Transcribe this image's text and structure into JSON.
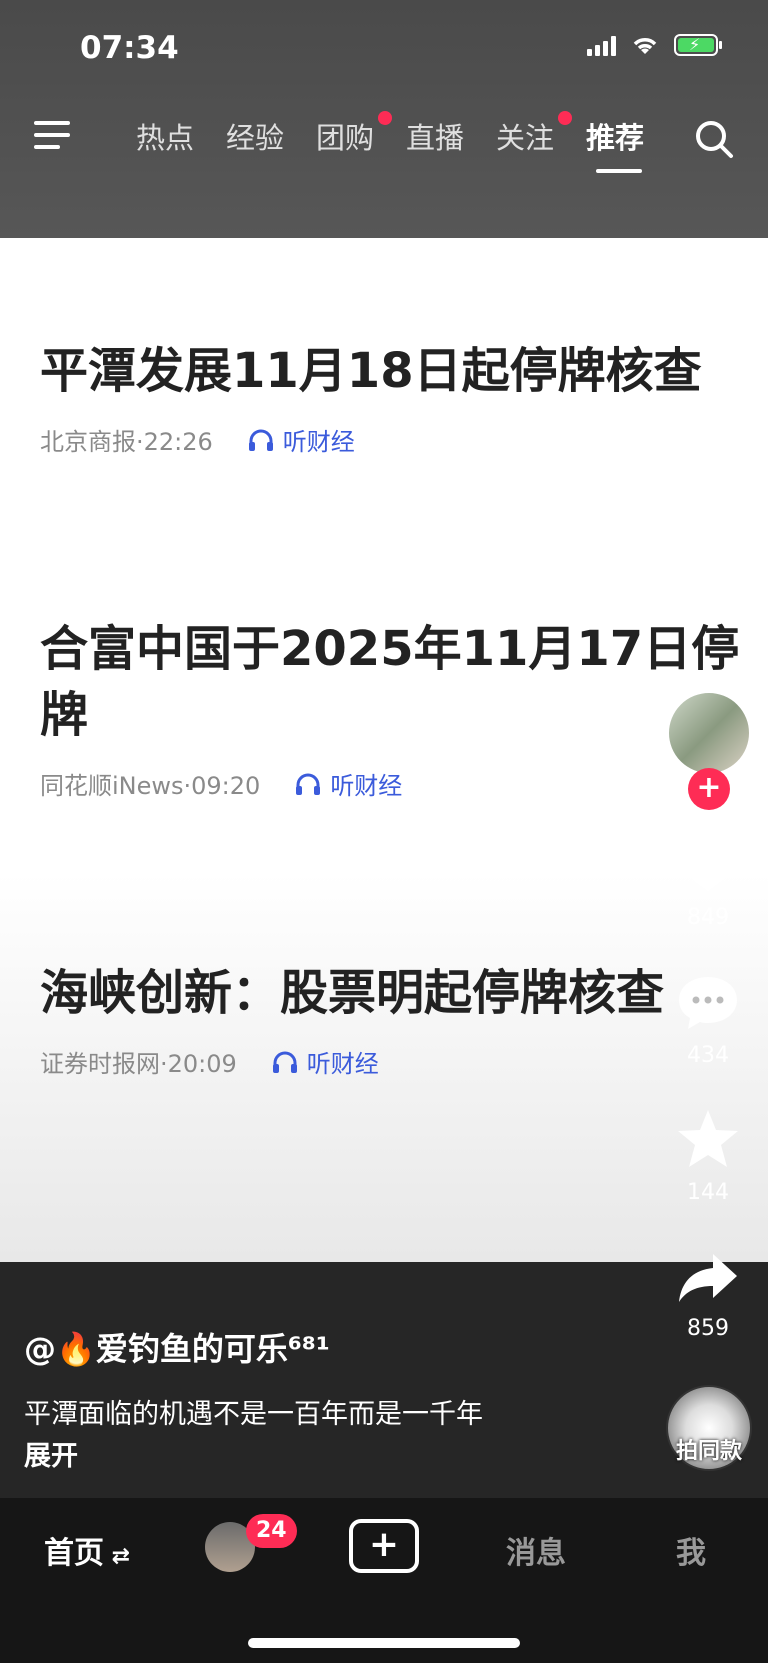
{
  "status": {
    "time": "07:34"
  },
  "nav": {
    "tabs": [
      {
        "label": "热点",
        "dot": false
      },
      {
        "label": "经验",
        "dot": false
      },
      {
        "label": "团购",
        "dot": true
      },
      {
        "label": "直播",
        "dot": false
      },
      {
        "label": "关注",
        "dot": true
      },
      {
        "label": "推荐",
        "dot": false,
        "active": true
      }
    ]
  },
  "news": [
    {
      "title": "平潭发展11月18日起停牌核查",
      "source": "北京商报·22:26",
      "listen": "听财经"
    },
    {
      "title": "合富中国于2025年11月17日停牌",
      "source": "同花顺iNews·09:20",
      "listen": "听财经"
    },
    {
      "title": "海峡创新：股票明起停牌核查",
      "source": "证券时报网·20:09",
      "listen": "听财经"
    }
  ],
  "actions": {
    "likes": "849",
    "comments": "434",
    "favorites": "144",
    "shares": "859",
    "same_style": "拍同款"
  },
  "post": {
    "author": "@🔥爱钓鱼的可乐⁶⁸¹",
    "description": "平潭面临的机遇不是一百年而是一千年",
    "expand": "展开"
  },
  "tabbar": {
    "home": "首页",
    "badge": "24",
    "messages": "消息",
    "me": "我"
  },
  "colors": {
    "accent": "#fe2c55",
    "link": "#3b5bdb"
  }
}
